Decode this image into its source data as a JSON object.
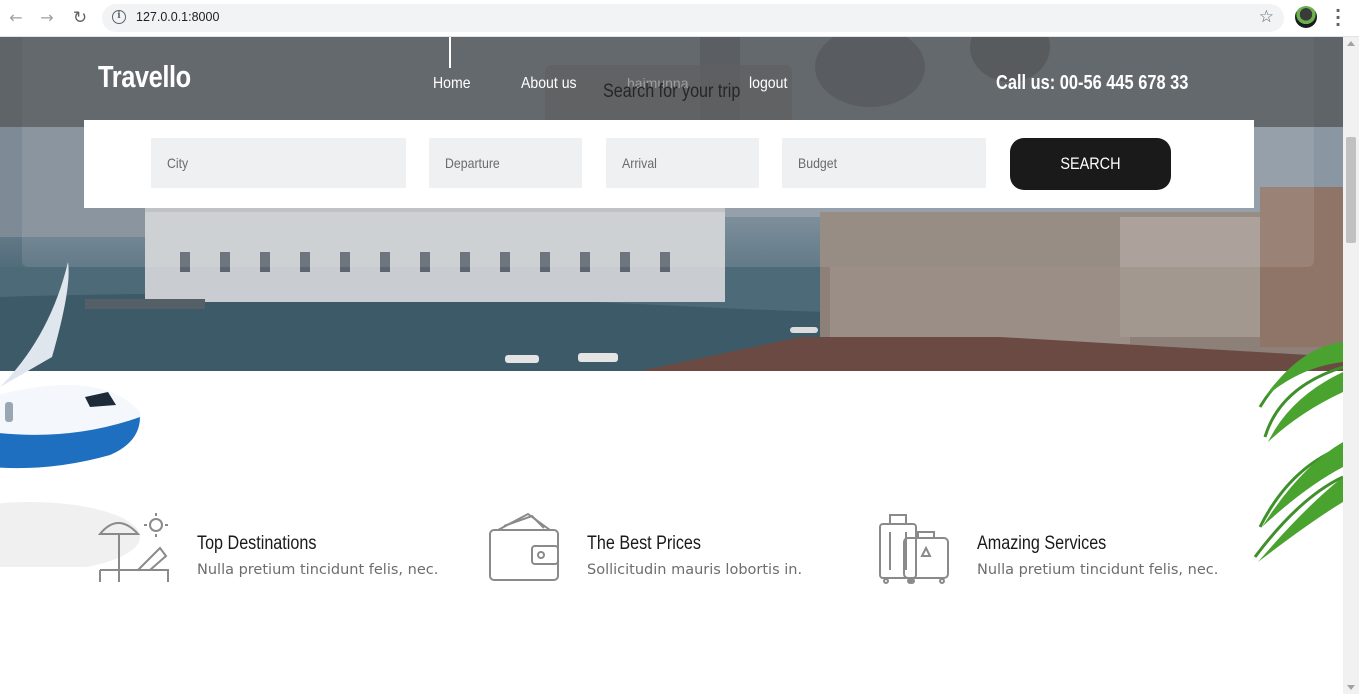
{
  "browser": {
    "url": "127.0.0.1:8000",
    "back_icon": "arrow-left-icon",
    "forward_icon": "arrow-right-icon",
    "reload_icon": "reload-icon",
    "info_icon": "info-icon",
    "star_icon": "star-icon",
    "menu_icon": "kebab-menu-icon"
  },
  "header": {
    "logo": "Travello",
    "nav": [
      {
        "label": "Home"
      },
      {
        "label": "About us"
      },
      {
        "label": "logout"
      }
    ],
    "username": "haimunna",
    "phone": "Call us: 00-56 445 678 33"
  },
  "search": {
    "title": "Search for your trip",
    "fields": {
      "city": "City",
      "departure": "Departure",
      "arrival": "Arrival",
      "budget": "Budget"
    },
    "button": "SEARCH"
  },
  "features": [
    {
      "icon": "beach-umbrella-icon",
      "title": "Top Destinations",
      "text": "Nulla pretium tincidunt felis, nec."
    },
    {
      "icon": "wallet-icon",
      "title": "The Best Prices",
      "text": "Sollicitudin mauris lobortis in."
    },
    {
      "icon": "luggage-icon",
      "title": "Amazing Services",
      "text": "Nulla pretium tincidunt felis, nec."
    }
  ],
  "colors": {
    "accent": "#1a1a1a",
    "input_bg": "#eef0f1",
    "text_muted": "#6d6d6d"
  }
}
